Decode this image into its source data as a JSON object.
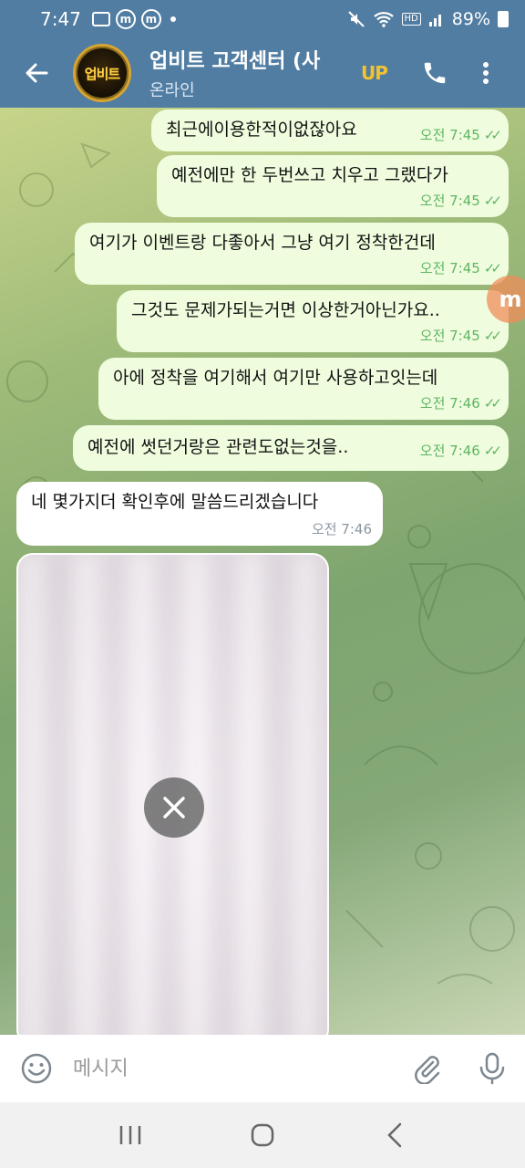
{
  "status_bar": {
    "time": "7:47",
    "battery": "89%",
    "app_badge": "m"
  },
  "header": {
    "title": "업비트 고객센터 (사",
    "badge": "UP",
    "status": "온라인",
    "avatar_text": "업비트"
  },
  "messages": [
    {
      "direction": "out",
      "text": "최근에이용한적이없잖아요",
      "time": "오전 7:45",
      "read": true
    },
    {
      "direction": "out",
      "text": "예전에만 한 두번쓰고 치우고 그랬다가",
      "time": "오전 7:45",
      "read": true
    },
    {
      "direction": "out",
      "text": "여기가 이벤트랑 다좋아서 그냥 여기 정착한건데",
      "time": "오전 7:45",
      "read": true
    },
    {
      "direction": "out",
      "text": "그것도 문제가되는거면 이상한거아닌가요..",
      "time": "오전 7:45",
      "read": true
    },
    {
      "direction": "out",
      "text": "아에 정착을 여기해서 여기만 사용하고잇는데",
      "time": "오전 7:46",
      "read": true
    },
    {
      "direction": "out",
      "text": "예전에 썻던거랑은 관련도없는것을..",
      "time": "오전 7:46",
      "read": true
    },
    {
      "direction": "in",
      "text": "네 몇가지더 확인후에 말씀드리겠습니다",
      "time": "오전 7:46",
      "read": false
    }
  ],
  "floating_badge": "m",
  "input": {
    "placeholder": "메시지"
  },
  "icons": {
    "back": "arrow-left-icon",
    "call": "phone-icon",
    "more": "more-vertical-icon",
    "emoji": "emoji-icon",
    "attach": "paperclip-icon",
    "mic": "microphone-icon",
    "cancel": "close-icon"
  },
  "colors": {
    "header": "#517da2",
    "outgoing_bubble": "#effdde",
    "incoming_bubble": "#ffffff",
    "check": "#5fb563"
  }
}
